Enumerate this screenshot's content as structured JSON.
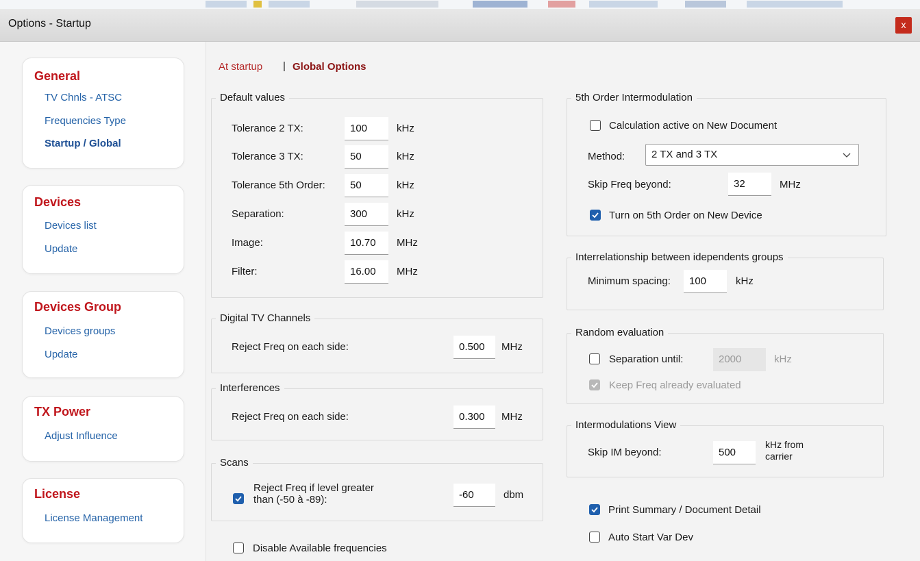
{
  "window": {
    "title": "Options - Startup",
    "close_glyph": "x"
  },
  "nav": {
    "sections": [
      {
        "heading": "General",
        "items": [
          "TV Chnls - ATSC",
          "Frequencies Type",
          "Startup / Global"
        ]
      },
      {
        "heading": "Devices",
        "items": [
          "Devices list",
          "Update"
        ]
      },
      {
        "heading": "Devices Group",
        "items": [
          "Devices groups",
          "Update"
        ]
      },
      {
        "heading": "TX Power",
        "items": [
          "Adjust Influence"
        ]
      },
      {
        "heading": "License",
        "items": [
          "License Management"
        ]
      }
    ],
    "active_item": "Startup / Global"
  },
  "tabs": {
    "at_startup": "At startup",
    "separator": "|",
    "global_options": "Global Options"
  },
  "default_values": {
    "legend": "Default values",
    "rows": [
      {
        "label": "Tolerance 2 TX:",
        "value": "100",
        "unit": "kHz"
      },
      {
        "label": "Tolerance 3 TX:",
        "value": "50",
        "unit": "kHz"
      },
      {
        "label": "Tolerance 5th Order:",
        "value": "50",
        "unit": "kHz"
      },
      {
        "label": "Separation:",
        "value": "300",
        "unit": "kHz"
      },
      {
        "label": "Image:",
        "value": "10.70",
        "unit": "MHz"
      },
      {
        "label": "Filter:",
        "value": "16.00",
        "unit": "MHz"
      }
    ]
  },
  "digital_tv": {
    "legend": "Digital TV Channels",
    "label": "Reject Freq on each side:",
    "value": "0.500",
    "unit": "MHz"
  },
  "interferences": {
    "legend": "Interferences",
    "label": "Reject Freq on each side:",
    "value": "0.300",
    "unit": "MHz"
  },
  "scans": {
    "legend": "Scans",
    "label_line1": "Reject Freq if level greater",
    "label_line2": "than (-50 à -89):",
    "checked": true,
    "value": "-60",
    "unit": "dbm"
  },
  "disable_available": {
    "label": "Disable Available frequencies",
    "checked": false
  },
  "fifth_order": {
    "legend": "5th Order Intermodulation",
    "calc_active": {
      "label": "Calculation active on New Document",
      "checked": false
    },
    "method_label": "Method:",
    "method_value": "2 TX and 3 TX",
    "skip_label": "Skip Freq beyond:",
    "skip_value": "32",
    "skip_unit": "MHz",
    "turn_on": {
      "label": "Turn on 5th Order on New Device",
      "checked": true
    }
  },
  "interrelationship": {
    "legend": "Interrelationship between idependents groups",
    "label": "Minimum spacing:",
    "value": "100",
    "unit": "kHz"
  },
  "random_eval": {
    "legend": "Random evaluation",
    "separation": {
      "label": "Separation until:",
      "checked": false,
      "value": "2000",
      "unit": "kHz"
    },
    "keep": {
      "label": "Keep Freq already evaluated",
      "checked": true
    }
  },
  "im_view": {
    "legend": "Intermodulations View",
    "label": "Skip IM beyond:",
    "value": "500",
    "unit_line1": "kHz from",
    "unit_line2": "carrier"
  },
  "print_summary": {
    "label": "Print Summary / Document Detail",
    "checked": true
  },
  "auto_start": {
    "label": "Auto Start Var Dev",
    "checked": false
  },
  "colors": {
    "accent": "#1f5fad",
    "heading_red": "#c0161c",
    "link_blue": "#2563a8",
    "close_red": "#c42b1c"
  }
}
